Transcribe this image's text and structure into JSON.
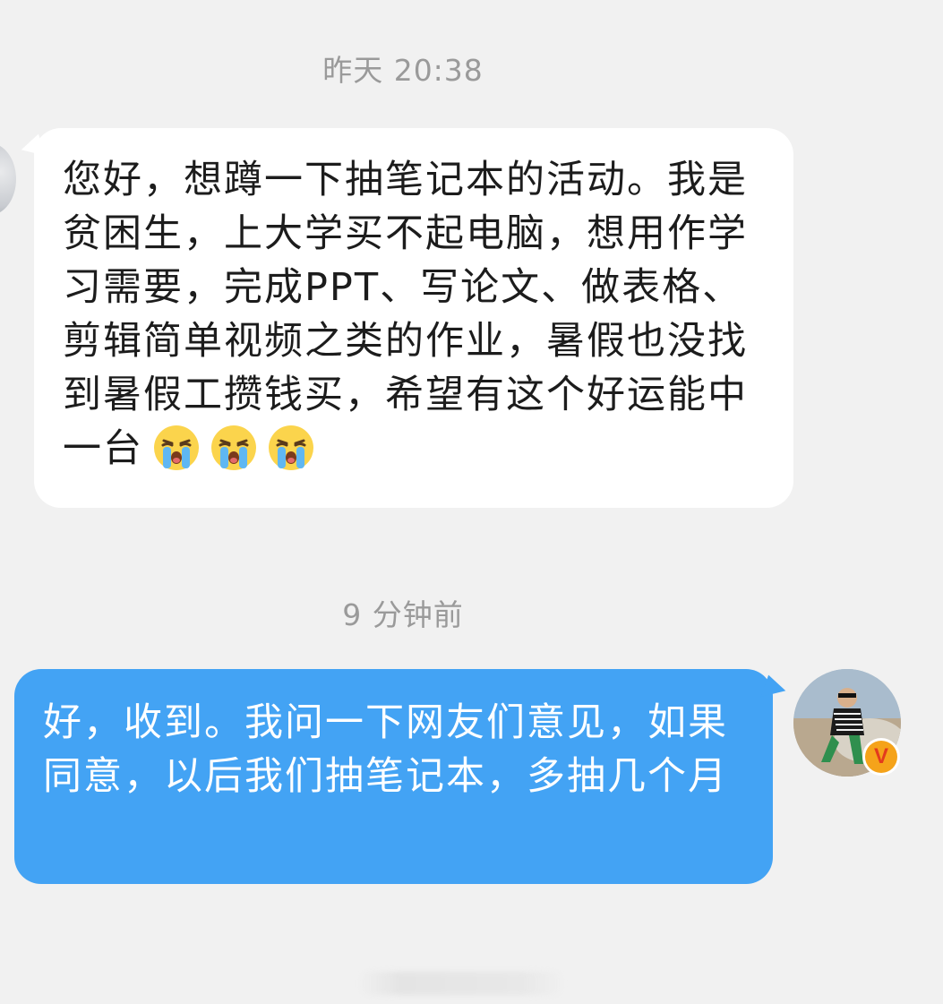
{
  "timestamps": {
    "first": "昨天 20:38",
    "second": "9 分钟前"
  },
  "messages": [
    {
      "direction": "incoming",
      "text": "您好，想蹲一下抽笔记本的活动。我是贫困生，上大学买不起电脑，想用作学习需要，完成PPT、写论文、做表格、剪辑简单视频之类的作业，暑假也没找到暑假工攒钱买，希望有这个好运能中一台",
      "emoji": [
        "loudly-crying-face",
        "loudly-crying-face",
        "loudly-crying-face"
      ]
    },
    {
      "direction": "outgoing",
      "text": "好，收到。我问一下网友们意见，如果同意，以后我们抽笔记本，多抽几个月"
    }
  ],
  "verify_badge": "V",
  "colors": {
    "background": "#f1f1f1",
    "incoming_bubble": "#ffffff",
    "outgoing_bubble": "#43a3f4",
    "timestamp_text": "#9a9a9a",
    "badge": "#f5a31a"
  }
}
